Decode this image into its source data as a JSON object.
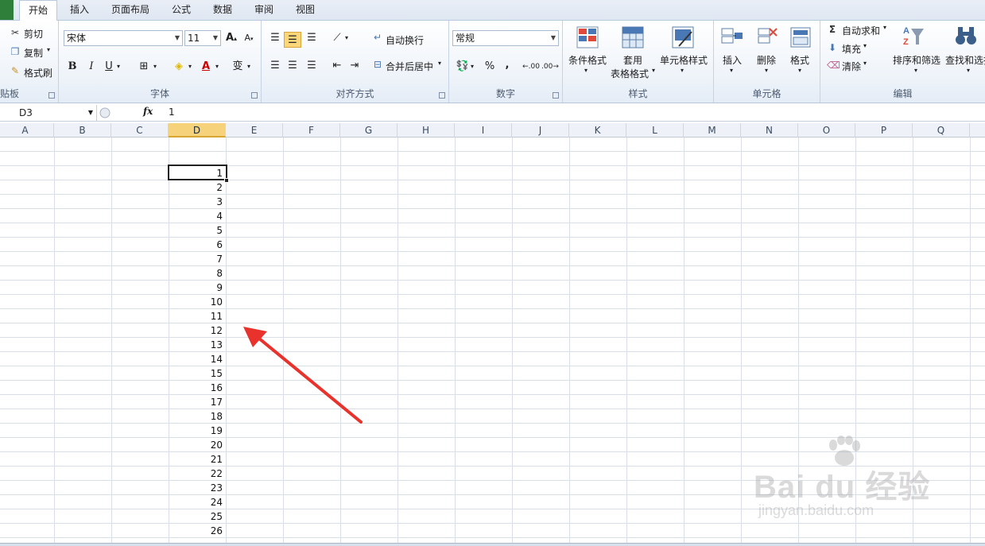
{
  "tabs": {
    "file": "",
    "items": [
      "开始",
      "插入",
      "页面布局",
      "公式",
      "数据",
      "审阅",
      "视图"
    ],
    "active": 0
  },
  "clipboard": {
    "cut": "剪切",
    "copy": "复制",
    "format_painter": "格式刷",
    "label": "剪贴板"
  },
  "font": {
    "name": "宋体",
    "size": "11",
    "bold": "B",
    "italic": "I",
    "underline": "U",
    "label": "字体"
  },
  "alignment": {
    "wrap_text": "自动换行",
    "merge_center": "合并后居中",
    "label": "对齐方式"
  },
  "number": {
    "format": "常规",
    "percent": "%",
    "comma": ",",
    "inc_decimal": ".00",
    "dec_decimal": ".00",
    "label": "数字"
  },
  "styles": {
    "conditional": "条件格式",
    "table_format_1": "套用",
    "table_format_2": "表格格式",
    "cell_styles": "单元格样式",
    "label": "样式"
  },
  "cells": {
    "insert": "插入",
    "delete": "删除",
    "format": "格式",
    "label": "单元格"
  },
  "editing": {
    "autosum": "自动求和",
    "fill": "填充",
    "clear": "清除",
    "sort_filter": "排序和筛选",
    "find_select": "查找和选择",
    "label": "编辑"
  },
  "formula_bar": {
    "name_box": "D3",
    "fx": "fx",
    "value": "1"
  },
  "columns": [
    "A",
    "B",
    "C",
    "D",
    "E",
    "F",
    "G",
    "H",
    "I",
    "J",
    "K",
    "L",
    "M",
    "N",
    "O",
    "P",
    "Q"
  ],
  "selected_column": "D",
  "cells_d": [
    "1",
    "2",
    "3",
    "4",
    "5",
    "6",
    "7",
    "8",
    "9",
    "10",
    "11",
    "12",
    "13",
    "14",
    "15",
    "16",
    "17",
    "18",
    "19",
    "20",
    "21",
    "22",
    "23",
    "24",
    "25",
    "26"
  ],
  "watermark": {
    "brand": "Bai du 经验",
    "url": "jingyan.baidu.com"
  },
  "colors": {
    "accent": "#2f7f3a",
    "selected_header": "#f6d27a",
    "arrow": "#e8322b"
  }
}
